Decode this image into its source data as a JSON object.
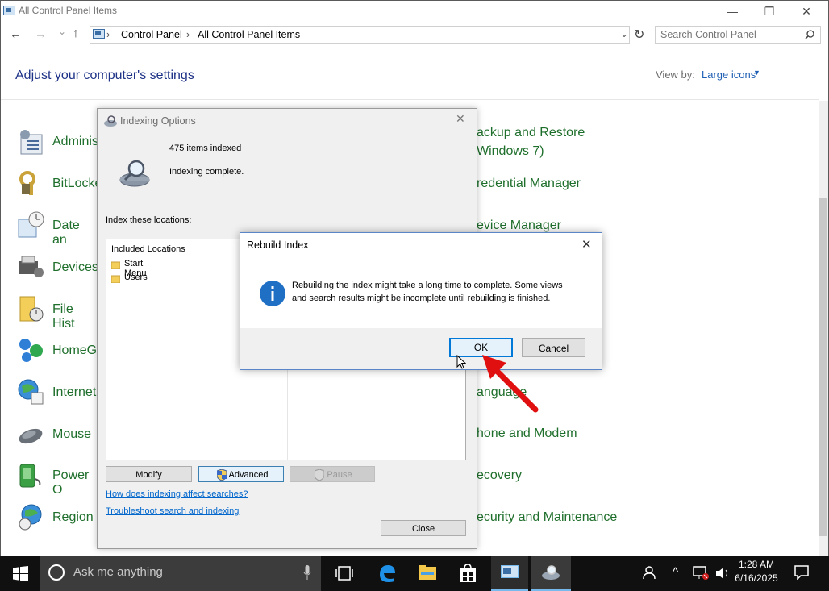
{
  "window": {
    "title": "All Control Panel Items",
    "minimize_glyph": "—",
    "restore_glyph": "❐",
    "close_glyph": "✕"
  },
  "nav": {
    "back_glyph": "←",
    "forward_glyph": "→",
    "down_glyph": "⌄",
    "up_glyph": "↑",
    "breadcrumb": [
      "Control Panel",
      "All Control Panel Items"
    ],
    "sep_glyph": "›",
    "dropdown_glyph": "⌄",
    "refresh_glyph": "↻"
  },
  "search": {
    "placeholder": "Search Control Panel"
  },
  "control_panel": {
    "heading": "Adjust your computer's settings",
    "view_by_label": "View by:",
    "view_by_value": "Large icons",
    "left_items": [
      "Adminis",
      "BitLocke",
      "Date an",
      "Devices",
      "File Hist",
      "HomeG",
      "Internet",
      "Mouse",
      "Power O",
      "Region"
    ],
    "right_items": [
      "ackup and Restore",
      "Windows 7)",
      "redential Manager",
      "evice Manager",
      "anguage",
      "hone and Modem",
      "ecovery",
      "ecurity and Maintenance"
    ]
  },
  "indexing_dialog": {
    "title": "Indexing Options",
    "items_indexed": "475 items indexed",
    "status": "Indexing complete.",
    "locations_label": "Index these locations:",
    "column_header": "Included Locations",
    "locations": [
      "Start Menu",
      "Users"
    ],
    "buttons": {
      "modify": "Modify",
      "advanced": "Advanced",
      "pause": "Pause",
      "close": "Close"
    },
    "link_how": "How does indexing affect searches?",
    "link_troubleshoot": "Troubleshoot search and indexing"
  },
  "rebuild_dialog": {
    "title": "Rebuild Index",
    "message_line1": "Rebuilding the index might take a long time to complete. Some views",
    "message_line2": "and search results might be incomplete until rebuilding is finished.",
    "ok": "OK",
    "cancel": "Cancel"
  },
  "taskbar": {
    "search_placeholder": "Ask me anything",
    "time": "1:28 AM",
    "date": "6/16/2025"
  },
  "colors": {
    "link": "#1e5fb4",
    "item_green": "#1f6f2c",
    "arrow_red": "#e01010",
    "info_blue": "#1f6fc5"
  }
}
